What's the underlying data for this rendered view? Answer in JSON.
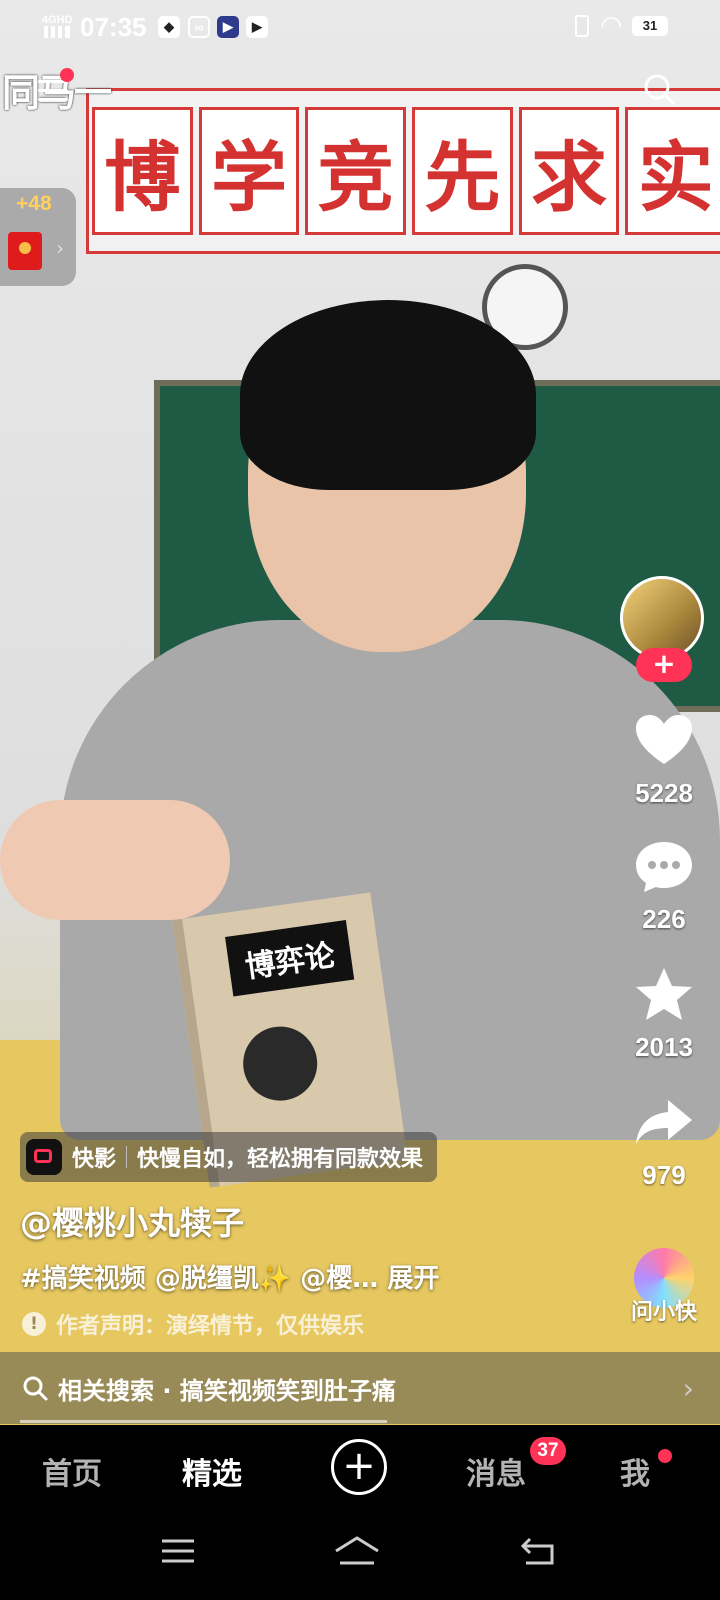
{
  "status_bar": {
    "network": "4GHD",
    "time": "07:35",
    "battery": "31"
  },
  "scene": {
    "banner_chars": [
      "博",
      "学",
      "竞",
      "先",
      "求",
      "实"
    ],
    "book_title": "博弈论"
  },
  "header": {
    "logo_text": "同马一",
    "red_packet_bonus": "+48"
  },
  "actions": {
    "likes": "5228",
    "comments": "226",
    "favorites": "2013",
    "shares": "979",
    "assistant_label": "问小快"
  },
  "promo": {
    "app_name": "快影",
    "text": "快慢自如，轻松拥有同款效果"
  },
  "post": {
    "author": "@樱桃小丸犊子",
    "caption": "#搞笑视频 @脱缰凯✨ @樱… 展开",
    "disclaimer": "作者声明：演绎情节，仅供娱乐"
  },
  "related_search": {
    "text": "相关搜索 · 搞笑视频笑到肚子痛"
  },
  "playback": {
    "progress": 0.54
  },
  "tabs": {
    "home": "首页",
    "featured": "精选",
    "create": "+",
    "messages": "消息",
    "messages_badge": "37",
    "me": "我"
  }
}
